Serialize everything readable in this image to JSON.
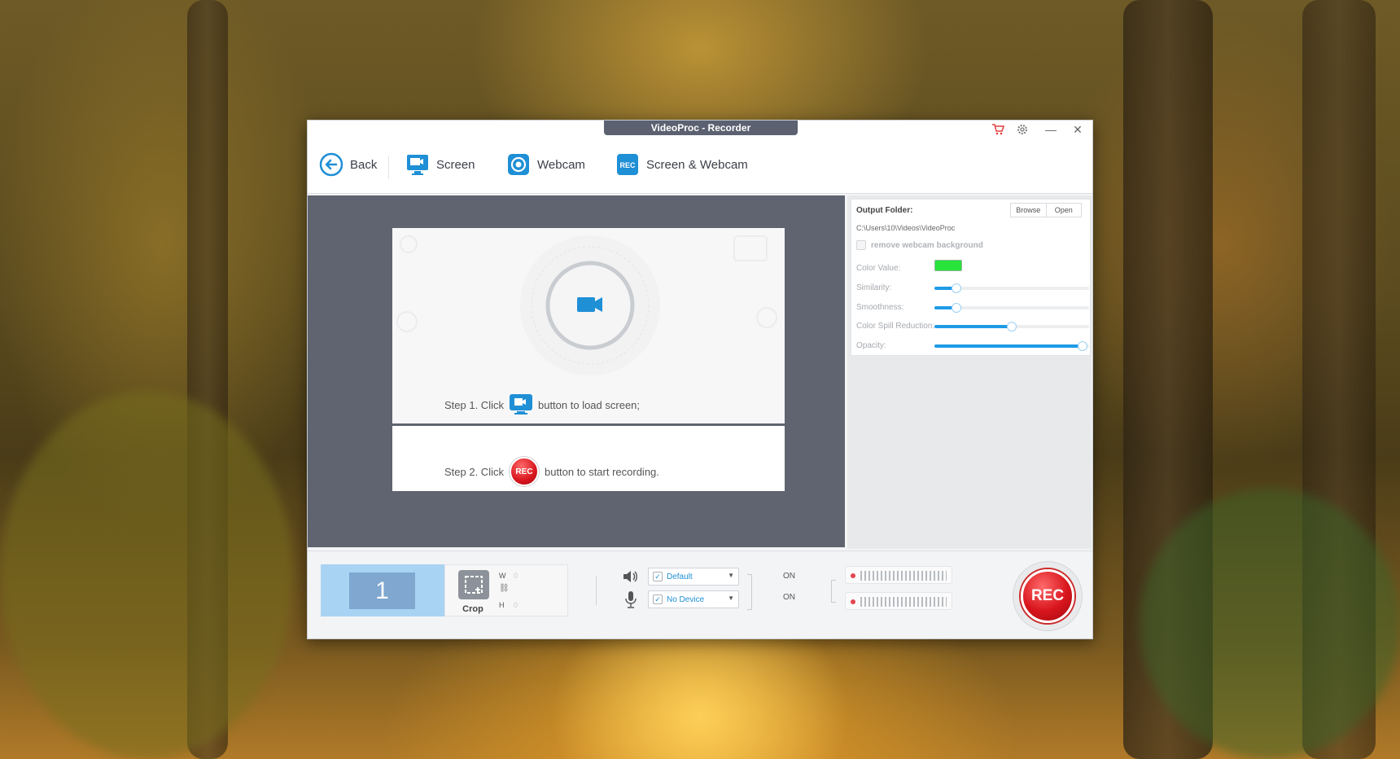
{
  "window": {
    "title": "VideoProc - Recorder"
  },
  "toolbar": {
    "back_label": "Back",
    "screen_label": "Screen",
    "webcam_label": "Webcam",
    "screen_webcam_label": "Screen & Webcam"
  },
  "preview": {
    "step1_prefix": "Step 1. Click",
    "step1_suffix": "button to load screen;",
    "step2_prefix": "Step 2. Click",
    "step2_suffix": "button to start recording.",
    "rec_icon_text": "REC"
  },
  "settings": {
    "output_folder_label": "Output Folder:",
    "browse_label": "Browse",
    "open_label": "Open",
    "output_path": "C:\\Users\\10\\Videos\\VideoProc",
    "remove_bg_label": "remove webcam background",
    "color_value_label": "Color Value:",
    "color_value": "#27e33a",
    "similarity_label": "Similarity:",
    "similarity_value": 0.14,
    "smoothness_label": "Smoothness:",
    "smoothness_value": 0.14,
    "spill_label": "Color Spill Reduction:",
    "spill_value": 0.5,
    "opacity_label": "Opacity:",
    "opacity_value": 0.96
  },
  "bottom": {
    "monitor_number": "1",
    "crop_label": "Crop",
    "w_label": "W",
    "h_label": "H",
    "w_value": "0",
    "h_value": "0",
    "speaker_device": "Default",
    "mic_device": "No Device",
    "speaker_state": "ON",
    "mic_state": "ON",
    "rec_label": "REC"
  },
  "colors": {
    "accent": "#1f8fd6",
    "rec_red": "#d8151d"
  }
}
